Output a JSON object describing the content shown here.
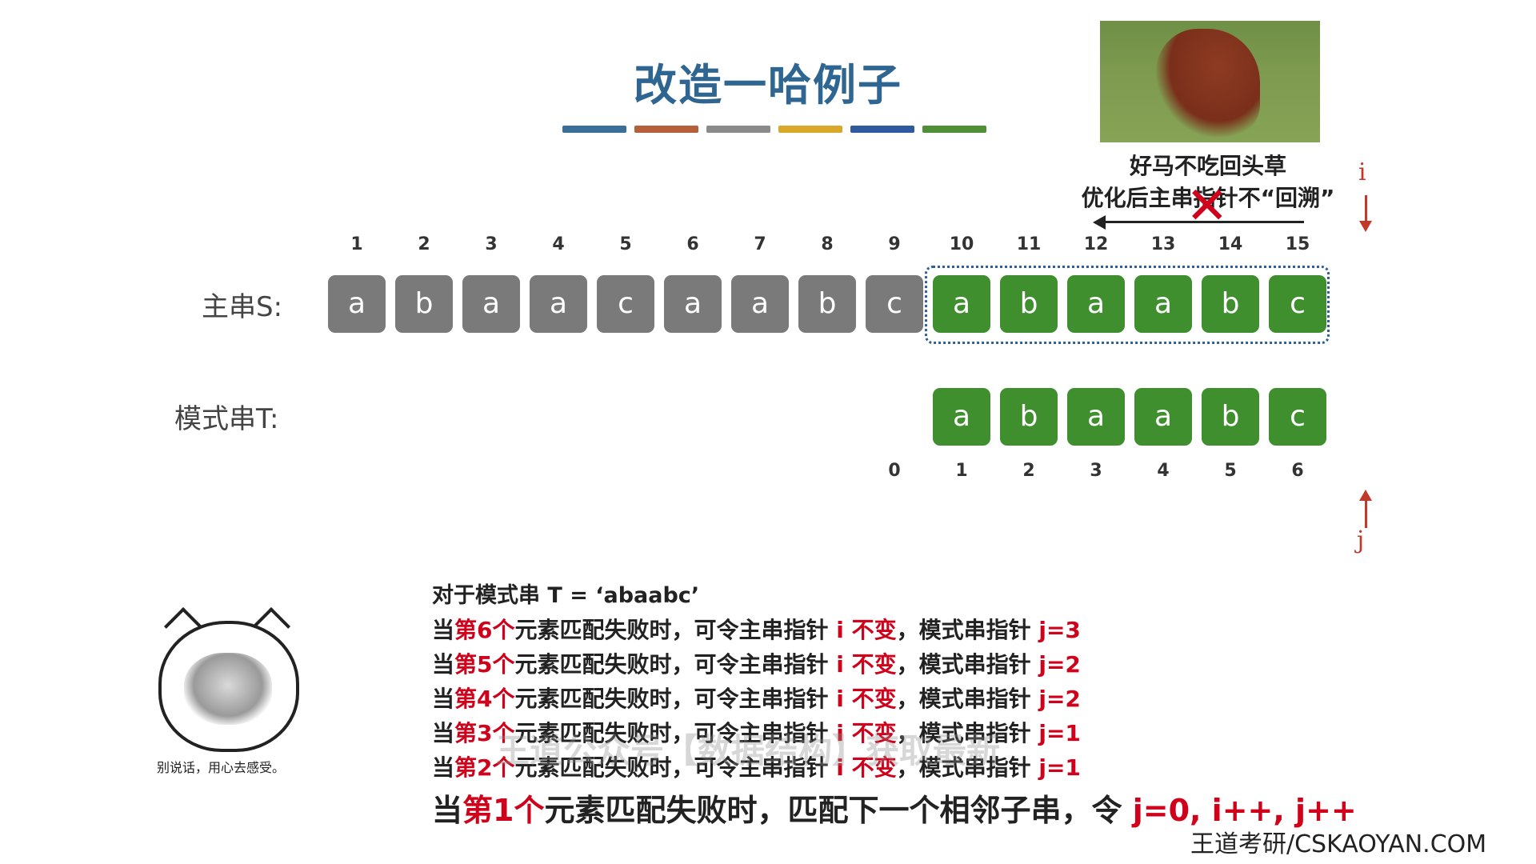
{
  "title": "改造一哈例子",
  "color_bars": [
    "#3a6f9a",
    "#b5603a",
    "#8a8a8a",
    "#d9a82a",
    "#2f5aa0",
    "#4f8f36"
  ],
  "side_caption": {
    "line1": "好马不吃回头草",
    "line2": "优化后主串指针不“回溯”"
  },
  "pointers": {
    "i": "i",
    "j": "j"
  },
  "main_string": {
    "label": "主串S:",
    "indices": [
      "1",
      "2",
      "3",
      "4",
      "5",
      "6",
      "7",
      "8",
      "9",
      "10",
      "11",
      "12",
      "13",
      "14",
      "15"
    ],
    "chars": [
      "a",
      "b",
      "a",
      "a",
      "c",
      "a",
      "a",
      "b",
      "c",
      "a",
      "b",
      "a",
      "a",
      "b",
      "c"
    ],
    "highlight_from": 10
  },
  "pattern_string": {
    "label": "模式串T:",
    "indices": [
      "0",
      "1",
      "2",
      "3",
      "4",
      "5",
      "6"
    ],
    "chars": [
      "a",
      "b",
      "a",
      "a",
      "b",
      "c"
    ]
  },
  "meme_caption": "别说话，用心去感受。",
  "description": {
    "heading": "对于模式串 T = ‘abaabc’",
    "rules": [
      {
        "pre": "当",
        "red": "第6个",
        "mid": "元素匹配失败时，可令主串指针 ",
        "i": "i 不变",
        "post": "，模式串指针 ",
        "j": "j=3"
      },
      {
        "pre": "当",
        "red": "第5个",
        "mid": "元素匹配失败时，可令主串指针 ",
        "i": "i 不变",
        "post": "，模式串指针 ",
        "j": "j=2"
      },
      {
        "pre": "当",
        "red": "第4个",
        "mid": "元素匹配失败时，可令主串指针 ",
        "i": "i 不变",
        "post": "，模式串指针 ",
        "j": "j=2"
      },
      {
        "pre": "当",
        "red": "第3个",
        "mid": "元素匹配失败时，可令主串指针 ",
        "i": "i 不变",
        "post": "，模式串指针 ",
        "j": "j=1"
      },
      {
        "pre": "当",
        "red": "第2个",
        "mid": "元素匹配失败时，可令主串指针 ",
        "i": "i 不变",
        "post": "，模式串指针 ",
        "j": "j=1"
      }
    ],
    "final": {
      "pre": "当",
      "red": "第1个",
      "mid": "元素匹配失败时，匹配下一个相邻子串，令 ",
      "tail": "j=0, i++, j++"
    }
  },
  "watermark": "王道公众号【数据结构】获取最新",
  "brand": "王道考研/CSKAOYAN.COM"
}
